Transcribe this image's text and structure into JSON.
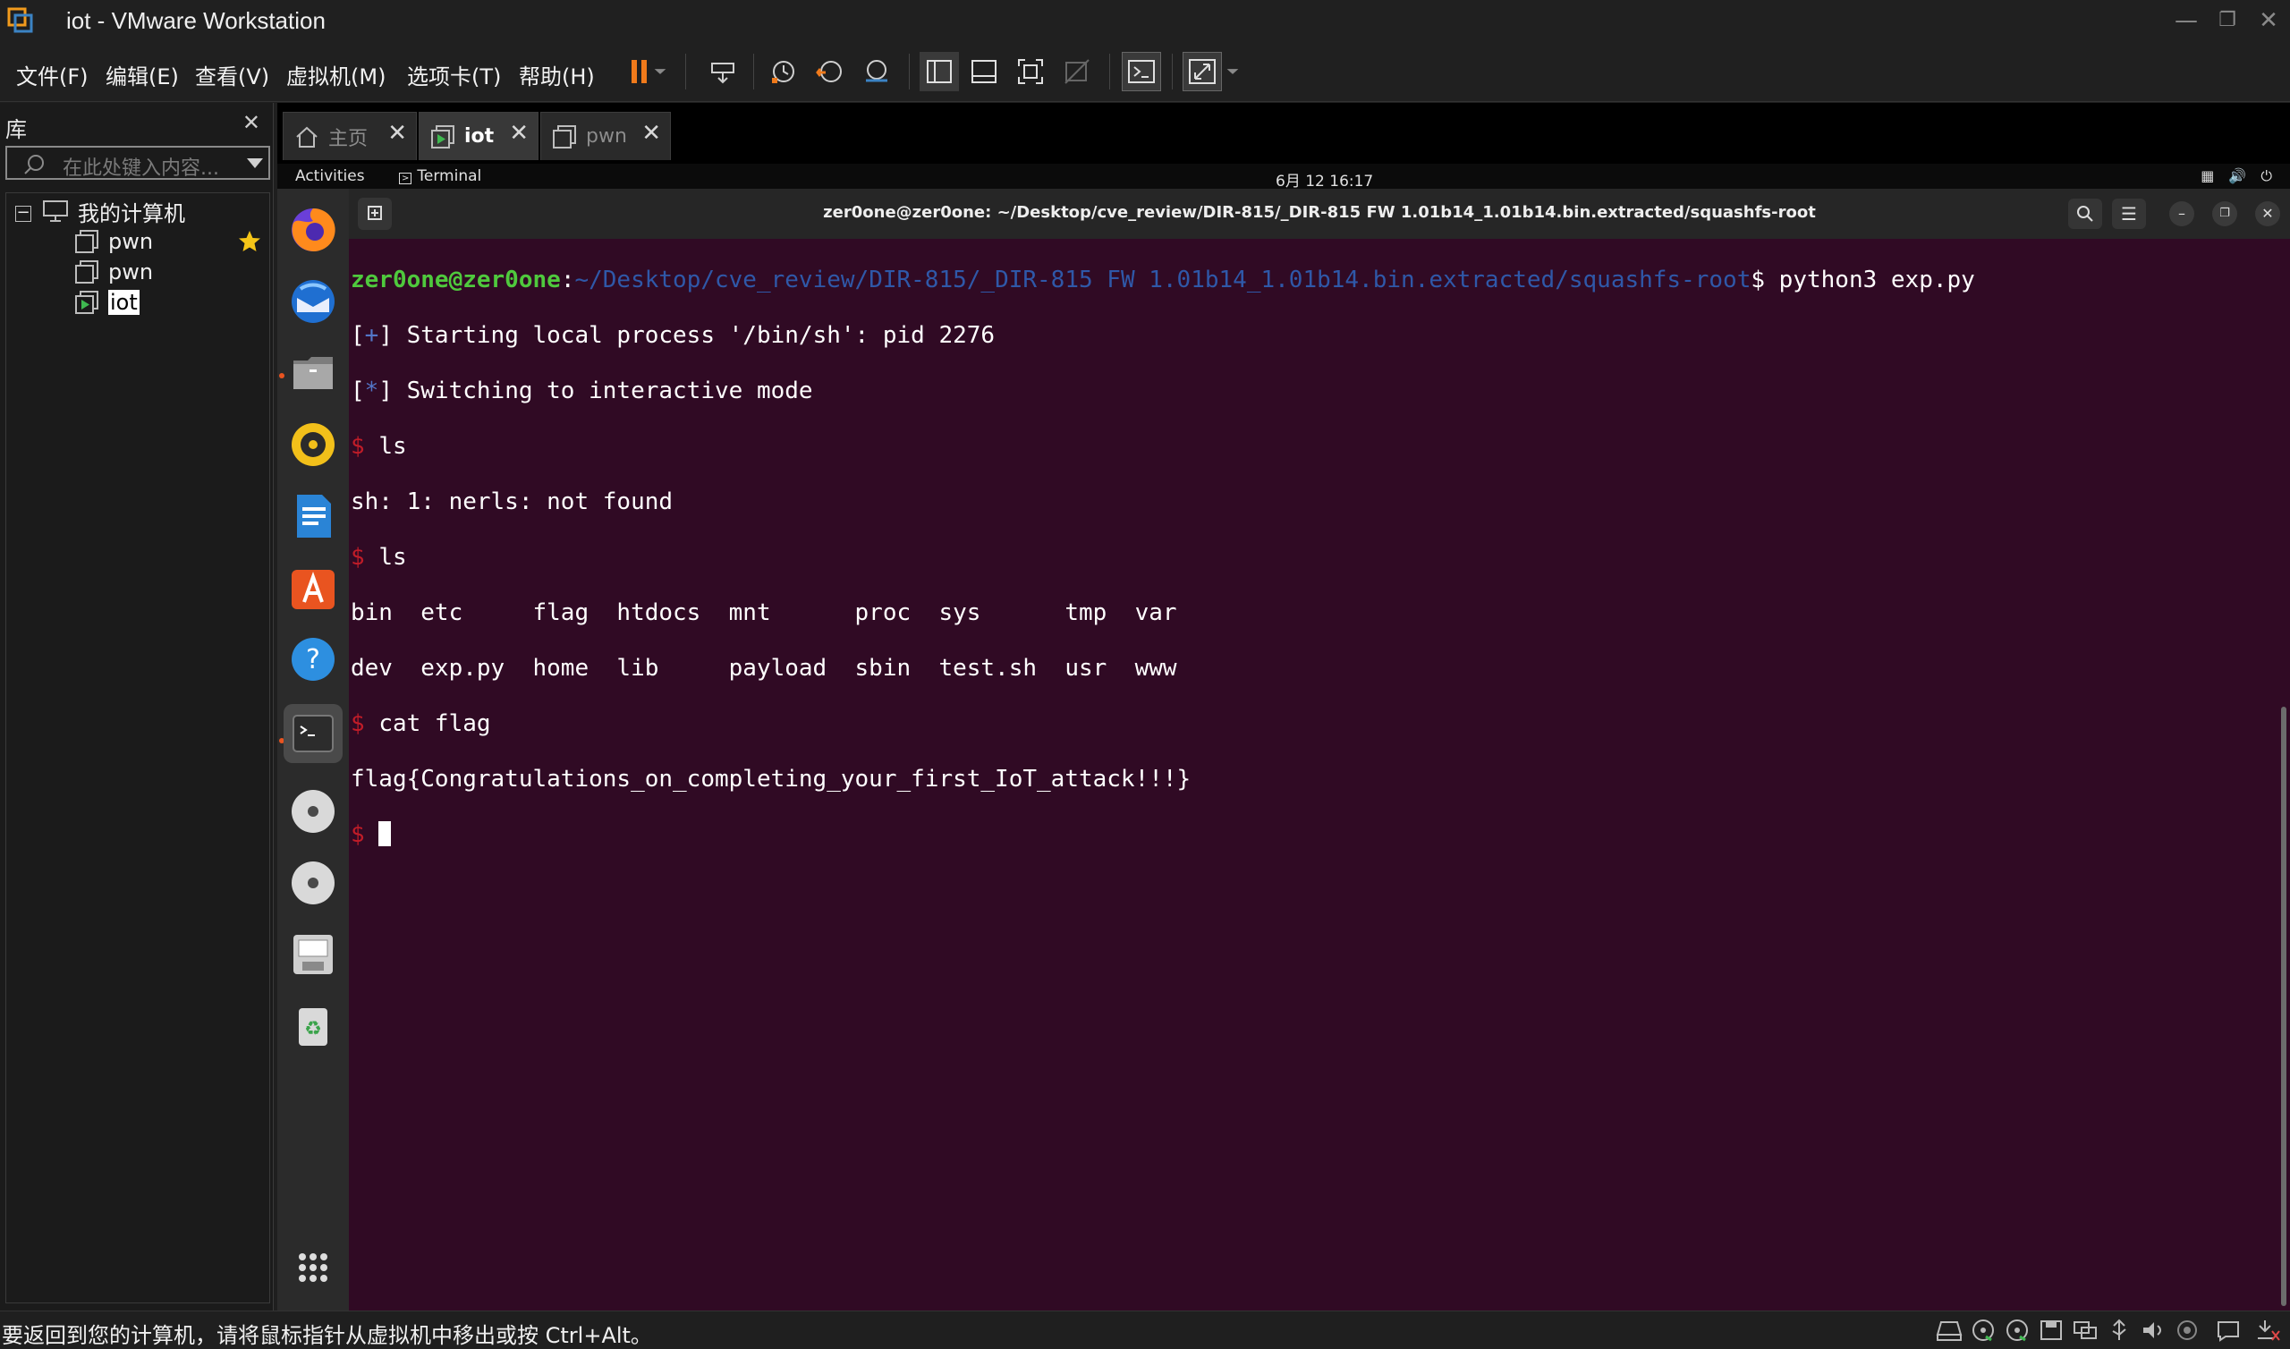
{
  "window": {
    "title": "iot - VMware Workstation"
  },
  "menu": [
    {
      "label": "文件(F)"
    },
    {
      "label": "编辑(E)"
    },
    {
      "label": "查看(V)"
    },
    {
      "label": "虚拟机(M)"
    },
    {
      "label": "选项卡(T)"
    },
    {
      "label": "帮助(H)"
    }
  ],
  "library": {
    "title": "库",
    "search_placeholder": "在此处键入内容...",
    "tree": {
      "root_label": "我的计算机",
      "vms": [
        {
          "label": "pwn",
          "favorite": true
        },
        {
          "label": "pwn",
          "favorite": false
        },
        {
          "label": "iot",
          "selected": true
        }
      ]
    }
  },
  "tabs": [
    {
      "label": "主页",
      "icon": "home-icon",
      "active": false
    },
    {
      "label": "iot",
      "icon": "vm-running-icon",
      "active": true
    },
    {
      "label": "pwn",
      "icon": "vm-icon",
      "active": false
    }
  ],
  "guest": {
    "topbar": {
      "activities": "Activities",
      "app": "Terminal",
      "clock": "6月 12  16:17"
    },
    "terminal": {
      "title": "zer0one@zer0one: ~/Desktop/cve_review/DIR-815/_DIR-815 FW 1.01b14_1.01b14.bin.extracted/squashfs-root",
      "prompt_user": "zer0one@zer0one",
      "prompt_sep": ":",
      "prompt_path": "~/Desktop/cve_review/DIR-815/_DIR-815 FW 1.01b14_1.01b14.bin.extracted/squashfs-root",
      "prompt_end": "$ ",
      "command": "python3 exp.py",
      "out1_pre": "[",
      "out1_mark": "+",
      "out1_post": "] Starting local process '/bin/sh': pid 2276",
      "out2_pre": "[",
      "out2_mark": "*",
      "out2_post": "] Switching to interactive mode",
      "dollar": "$ ",
      "cmd_ls1": "ls",
      "err_line": "sh: 1: nerls: not found",
      "cmd_ls2": "ls",
      "ls_row1": "bin  etc     flag  htdocs  mnt      proc  sys      tmp  var",
      "ls_row2": "dev  exp.py  home  lib     payload  sbin  test.sh  usr  www",
      "cmd_cat": "cat flag",
      "flag": "flag{Congratulations_on_completing_your_first_IoT_attack!!!}"
    }
  },
  "statusbar": {
    "hint": "要返回到您的计算机，请将鼠标指针从虚拟机中移出或按 Ctrl+Alt。"
  },
  "colors": {
    "terminal_bg": "#300a24",
    "prompt_user": "#4fc93d",
    "prompt_path": "#2f58a8",
    "accent_orange": "#e95420"
  }
}
